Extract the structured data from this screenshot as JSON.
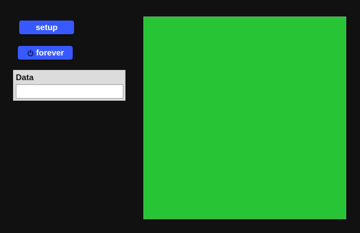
{
  "buttons": {
    "setup_label": "setup",
    "forever_label": "forever"
  },
  "monitor": {
    "label": "Data",
    "value": ""
  },
  "world": {
    "background_color": "#27c436"
  },
  "colors": {
    "button": "#3759ff",
    "page_background": "#111111"
  },
  "icons": {
    "forever": "power-icon"
  }
}
